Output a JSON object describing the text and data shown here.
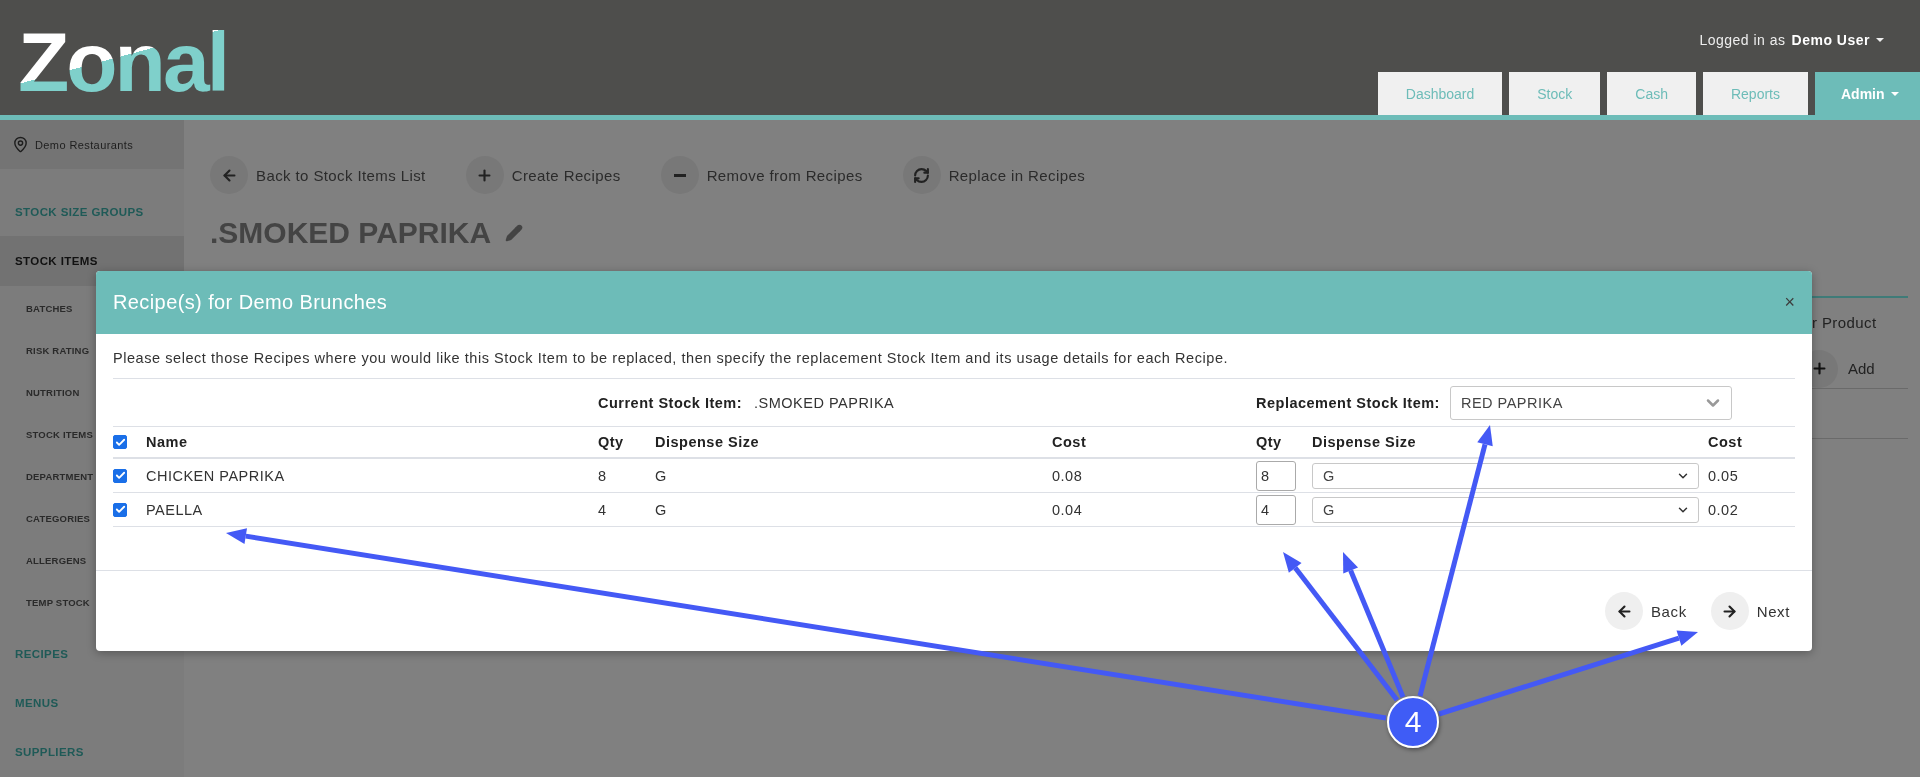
{
  "header": {
    "logo": "Zonal",
    "user_prefix": "Logged in as",
    "user_name": "Demo User",
    "nav_tabs": [
      {
        "label": "Dashboard",
        "selected": false
      },
      {
        "label": "Stock",
        "selected": false
      },
      {
        "label": "Cash",
        "selected": false
      },
      {
        "label": "Reports",
        "selected": false
      },
      {
        "label": "Admin",
        "selected": true
      }
    ]
  },
  "sidebar": {
    "location": "Demo Restaurants",
    "items": [
      {
        "label": "STOCK SIZE GROUPS",
        "selected": false
      },
      {
        "label": "STOCK ITEMS",
        "selected": true,
        "children": [
          {
            "label": "BATCHES"
          },
          {
            "label": "RISK RATING"
          },
          {
            "label": "NUTRITION"
          },
          {
            "label": "STOCK ITEMS"
          },
          {
            "label": "DEPARTMENT"
          },
          {
            "label": "CATEGORIES"
          },
          {
            "label": "ALLERGENS"
          },
          {
            "label": "TEMP STOCK"
          }
        ]
      },
      {
        "label": "RECIPES",
        "selected": false
      },
      {
        "label": "MENUS",
        "selected": false
      },
      {
        "label": "SUPPLIERS",
        "selected": false
      }
    ]
  },
  "page": {
    "actions": [
      {
        "kind": "back",
        "label": "Back to Stock Items List"
      },
      {
        "kind": "plus",
        "label": "Create Recipes"
      },
      {
        "kind": "minus",
        "label": "Remove from Recipes"
      },
      {
        "kind": "refresh",
        "label": "Replace in Recipes"
      }
    ],
    "title": ".SMOKED PAPRIKA",
    "side_text": "r Product",
    "side_button": "Add"
  },
  "modal": {
    "title": "Recipe(s) for Demo Brunches",
    "close": "×",
    "instructions": "Please select those Recipes where you would like this Stock Item to be replaced, then specify the replacement Stock Item and its usage details for each Recipe.",
    "current_label": "Current Stock Item:",
    "current_value": ".SMOKED PAPRIKA",
    "replacement_label": "Replacement Stock Item:",
    "replacement_value": "RED PAPRIKA",
    "all_checked": true,
    "columns": [
      "Name",
      "Qty",
      "Dispense Size",
      "Cost",
      "Qty",
      "Dispense Size",
      "Cost"
    ],
    "rows": [
      {
        "checked": true,
        "name": "CHICKEN PAPRIKA",
        "qty": "8",
        "dispense": "G",
        "cost": "0.08",
        "new_qty": "8",
        "new_dispense": "G",
        "new_cost": "0.05"
      },
      {
        "checked": true,
        "name": "PAELLA",
        "qty": "4",
        "dispense": "G",
        "cost": "0.04",
        "new_qty": "4",
        "new_dispense": "G",
        "new_cost": "0.02"
      }
    ],
    "buttons": [
      {
        "kind": "back",
        "label": "Back"
      },
      {
        "kind": "next",
        "label": "Next"
      }
    ]
  },
  "callout": {
    "number": "4"
  }
}
